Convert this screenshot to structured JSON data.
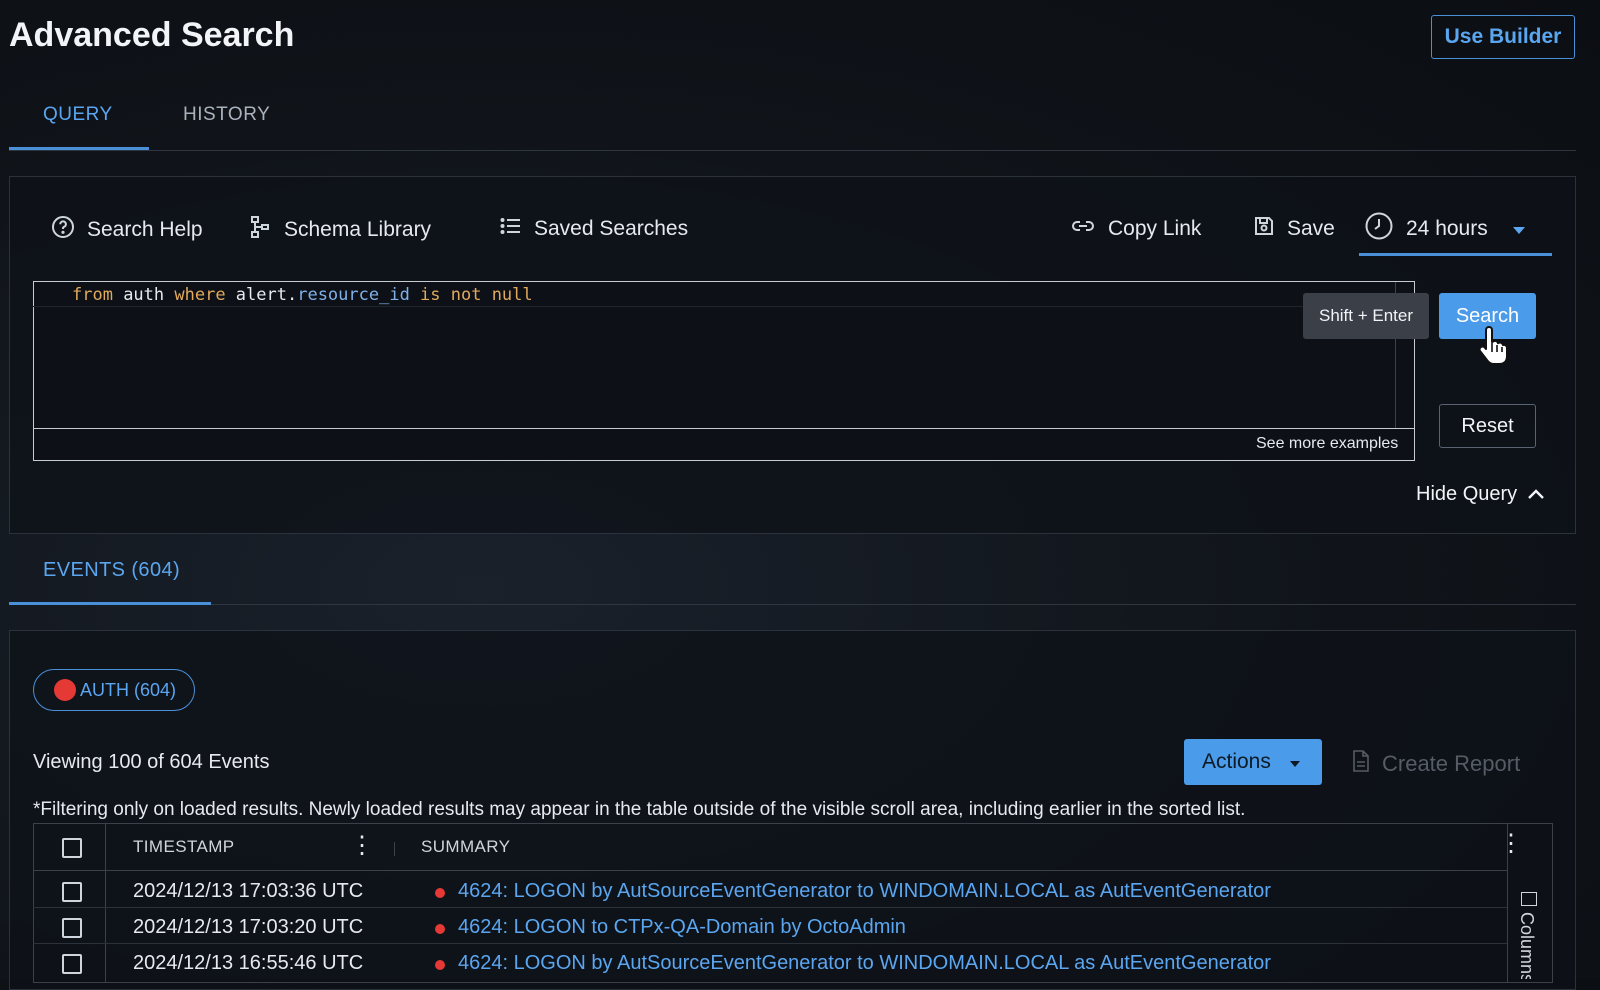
{
  "header": {
    "title": "Advanced Search",
    "builder_button": "Use Builder"
  },
  "tabs": [
    {
      "label": "QUERY",
      "active": true
    },
    {
      "label": "HISTORY",
      "active": false
    }
  ],
  "toolbar": {
    "search_help": "Search Help",
    "schema_library": "Schema Library",
    "saved_searches": "Saved Searches",
    "copy_link": "Copy Link",
    "save": "Save",
    "time_range": "24 hours"
  },
  "editor": {
    "query_tokens": [
      {
        "text": "from",
        "kind": "kw"
      },
      {
        "text": " auth ",
        "kind": "id"
      },
      {
        "text": "where",
        "kind": "kw"
      },
      {
        "text": " alert.",
        "kind": "id"
      },
      {
        "text": "resource_id",
        "kind": "prop"
      },
      {
        "text": " is not null",
        "kind": "kw"
      }
    ],
    "see_more": "See more examples"
  },
  "actions": {
    "tooltip": "Shift + Enter",
    "search": "Search",
    "reset": "Reset",
    "hide_query": "Hide Query"
  },
  "events": {
    "tab_label": "EVENTS (604)",
    "chip_label": "AUTH (604)",
    "viewing": "Viewing 100 of 604 Events",
    "actions_button": "Actions",
    "create_report": "Create Report",
    "filter_note": "*Filtering only on loaded results.  Newly loaded results may appear in the table outside of the visible scroll area, including earlier in the sorted list."
  },
  "table": {
    "headers": {
      "timestamp": "TIMESTAMP",
      "summary": "SUMMARY"
    },
    "columns_label": "Columns",
    "rows": [
      {
        "timestamp": "2024/12/13 17:03:36 UTC",
        "summary": "4624: LOGON by AutSourceEventGenerator to WINDOMAIN.LOCAL as AutEventGenerator"
      },
      {
        "timestamp": "2024/12/13 17:03:20 UTC",
        "summary": "4624: LOGON to CTPx-QA-Domain by OctoAdmin"
      },
      {
        "timestamp": "2024/12/13 16:55:46 UTC",
        "summary": "4624: LOGON by AutSourceEventGenerator to WINDOMAIN.LOCAL as AutEventGenerator"
      }
    ]
  },
  "colors": {
    "accent": "#4a9be9",
    "link": "#5aa6f0",
    "alert": "#e53935"
  }
}
